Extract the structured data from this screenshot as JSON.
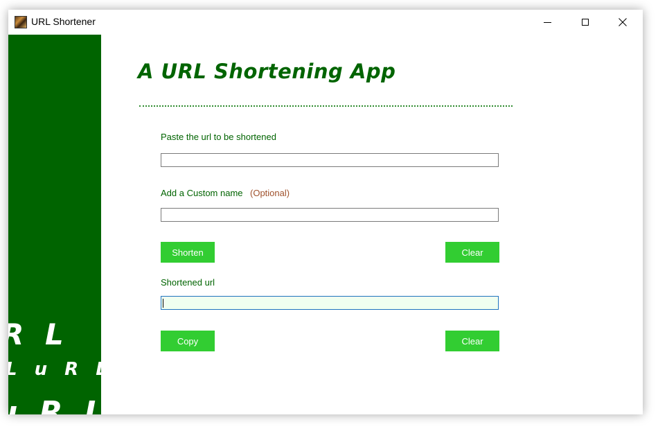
{
  "window": {
    "title": "URL Shortener",
    "minimize": "—",
    "maximize": "☐",
    "close": "✕"
  },
  "sidebar": {
    "background_color": "#006400",
    "text_1": "R L",
    "text_2": "L   u R L",
    "text_3": "u R L"
  },
  "main": {
    "heading": "A URL Shortening App",
    "url_label": "Paste the url to be shortened",
    "url_value": "",
    "custom_label": "Add a Custom name",
    "custom_optional": "(Optional)",
    "custom_value": "",
    "shorten_button": "Shorten",
    "clear_button_1": "Clear",
    "shortened_label": "Shortened url",
    "shortened_value": "",
    "copy_button": "Copy",
    "clear_button_2": "Clear"
  },
  "colors": {
    "accent_green": "#006400",
    "button_green": "#32cd32",
    "optional_brown": "#a0522d"
  }
}
